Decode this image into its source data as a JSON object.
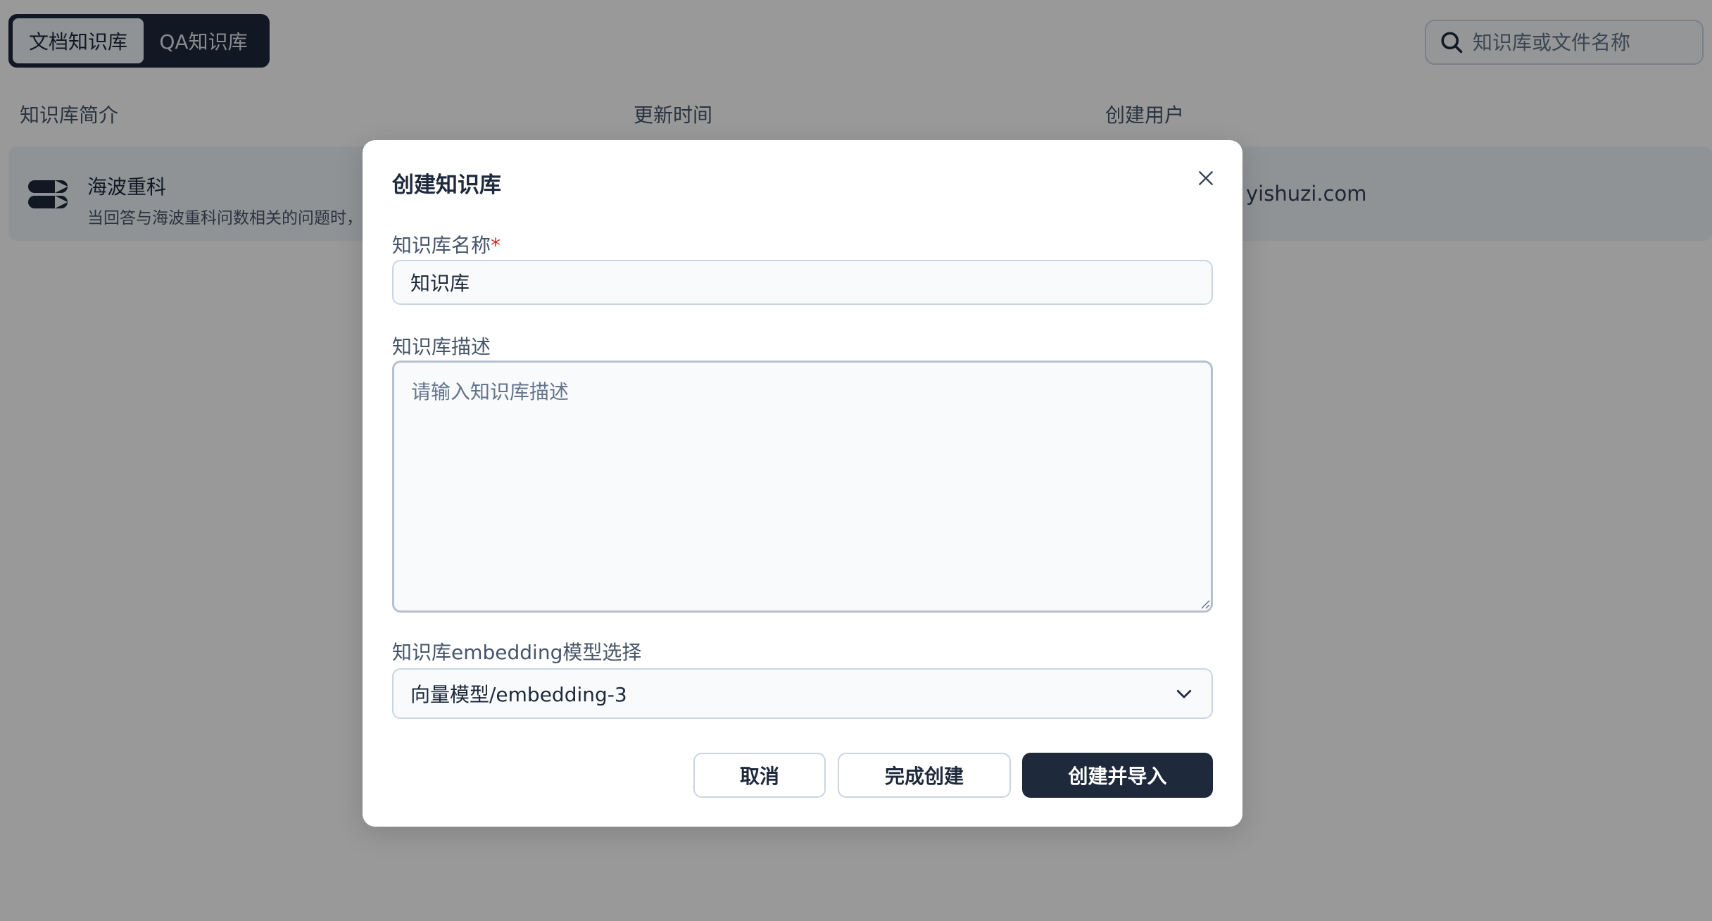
{
  "tabs": {
    "document_kb": "文档知识库",
    "qa_kb": "QA知识库"
  },
  "search": {
    "placeholder": "知识库或文件名称"
  },
  "table": {
    "headers": {
      "intro": "知识库简介",
      "updated": "更新时间",
      "creator": "创建用户"
    },
    "rows": [
      {
        "title": "海波重科",
        "description": "当回答与海波重科问数相关的问题时，",
        "creator_visible": "yishuzi.com"
      }
    ]
  },
  "modal": {
    "title": "创建知识库",
    "name_label": "知识库名称",
    "required_mark": "*",
    "name_value": "知识库",
    "desc_label": "知识库描述",
    "desc_placeholder": "请输入知识库描述",
    "model_label": "知识库embedding模型选择",
    "model_value": "向量模型/embedding-3",
    "buttons": {
      "cancel": "取消",
      "finish": "完成创建",
      "create_import": "创建并导入"
    }
  },
  "colors": {
    "primary": "#1e293b",
    "overlay": "rgba(0,0,0,0.40)",
    "required": "#dc2626"
  }
}
